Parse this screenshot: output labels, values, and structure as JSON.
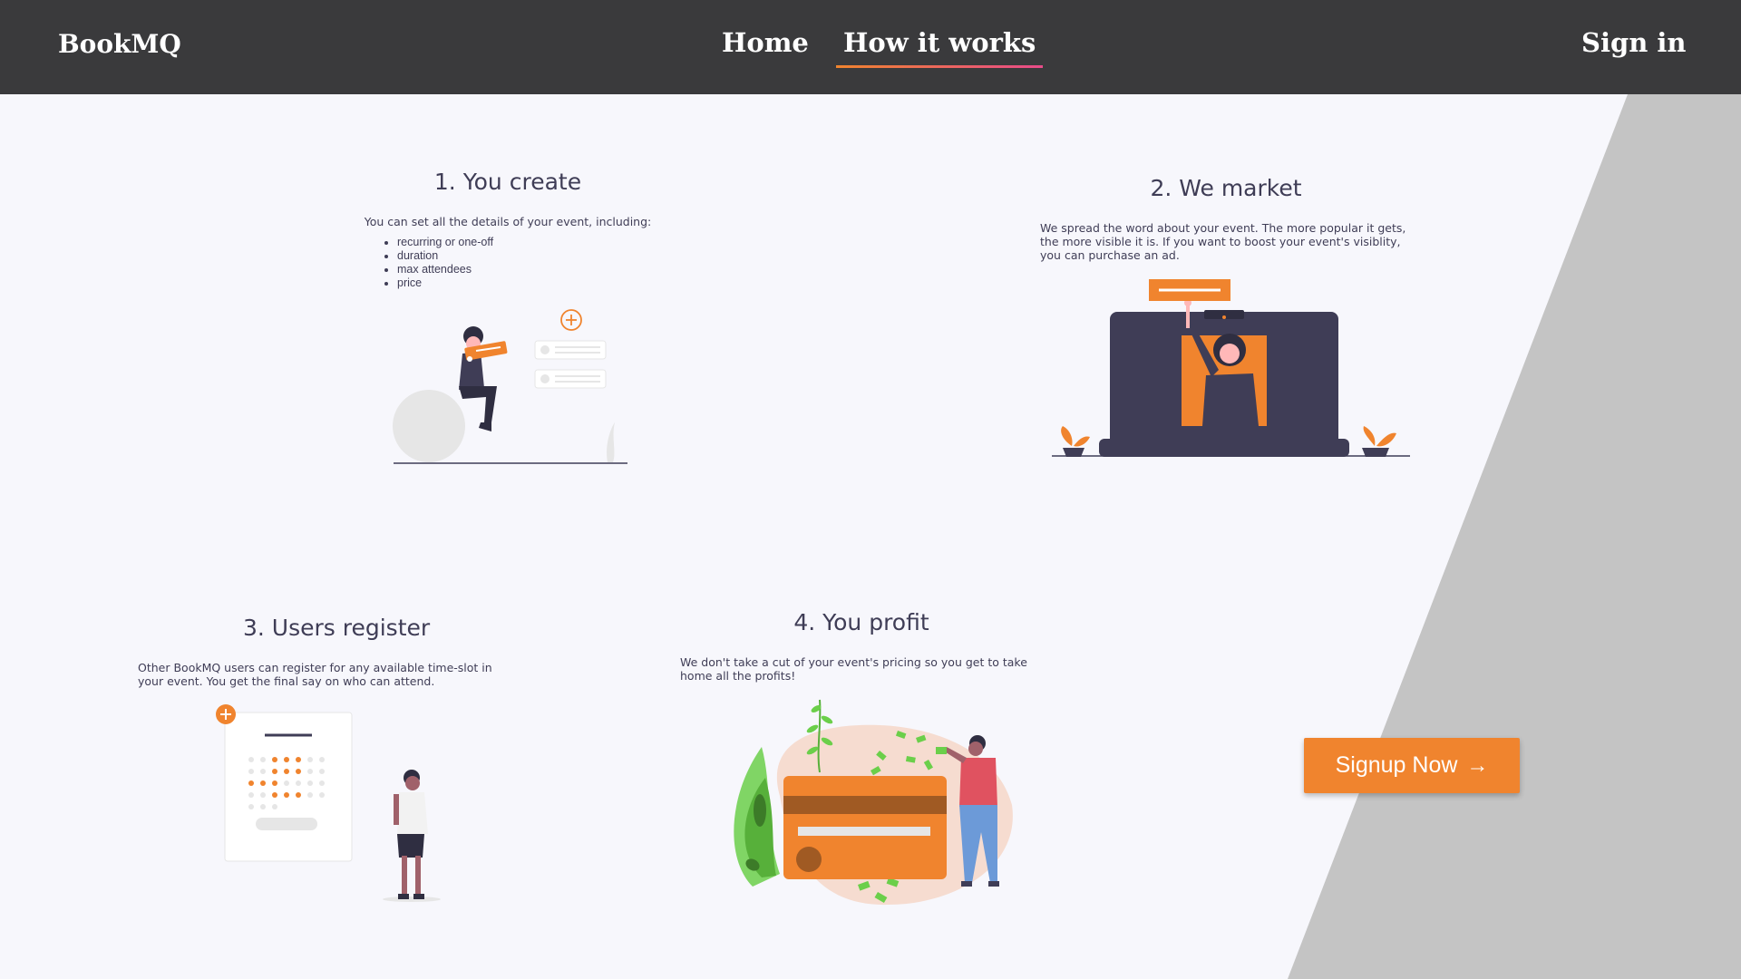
{
  "nav": {
    "brand": "BookMQ",
    "links": [
      {
        "label": "Home",
        "active": false
      },
      {
        "label": "How it works",
        "active": true
      }
    ],
    "signin": "Sign in"
  },
  "steps": [
    {
      "title": "1. You create",
      "text": "You can set all the details of your event, including:",
      "bullets": [
        "recurring or one-off",
        "duration",
        "max attendees",
        "price"
      ]
    },
    {
      "title": "2. We market",
      "text": "We spread the word about your event. The more popular it gets, the more visible it is. If you want to boost your event's visiblity, you can purchase an ad."
    },
    {
      "title": "3. Users register",
      "text": "Other BookMQ users can register for any available time-slot in your event. You get the final say on who can attend."
    },
    {
      "title": "4. You profit",
      "text": "We don't take a cut of your event's pricing so you get to take home all the profits!"
    }
  ],
  "cta": {
    "label": "Signup Now",
    "icon": "arrow-right-icon"
  },
  "colors": {
    "navbar": "#3a3a3c",
    "background": "#f7f7fc",
    "accent": "#f0842e",
    "stripe": "#c4c4c4",
    "dark": "#3f3d56"
  }
}
